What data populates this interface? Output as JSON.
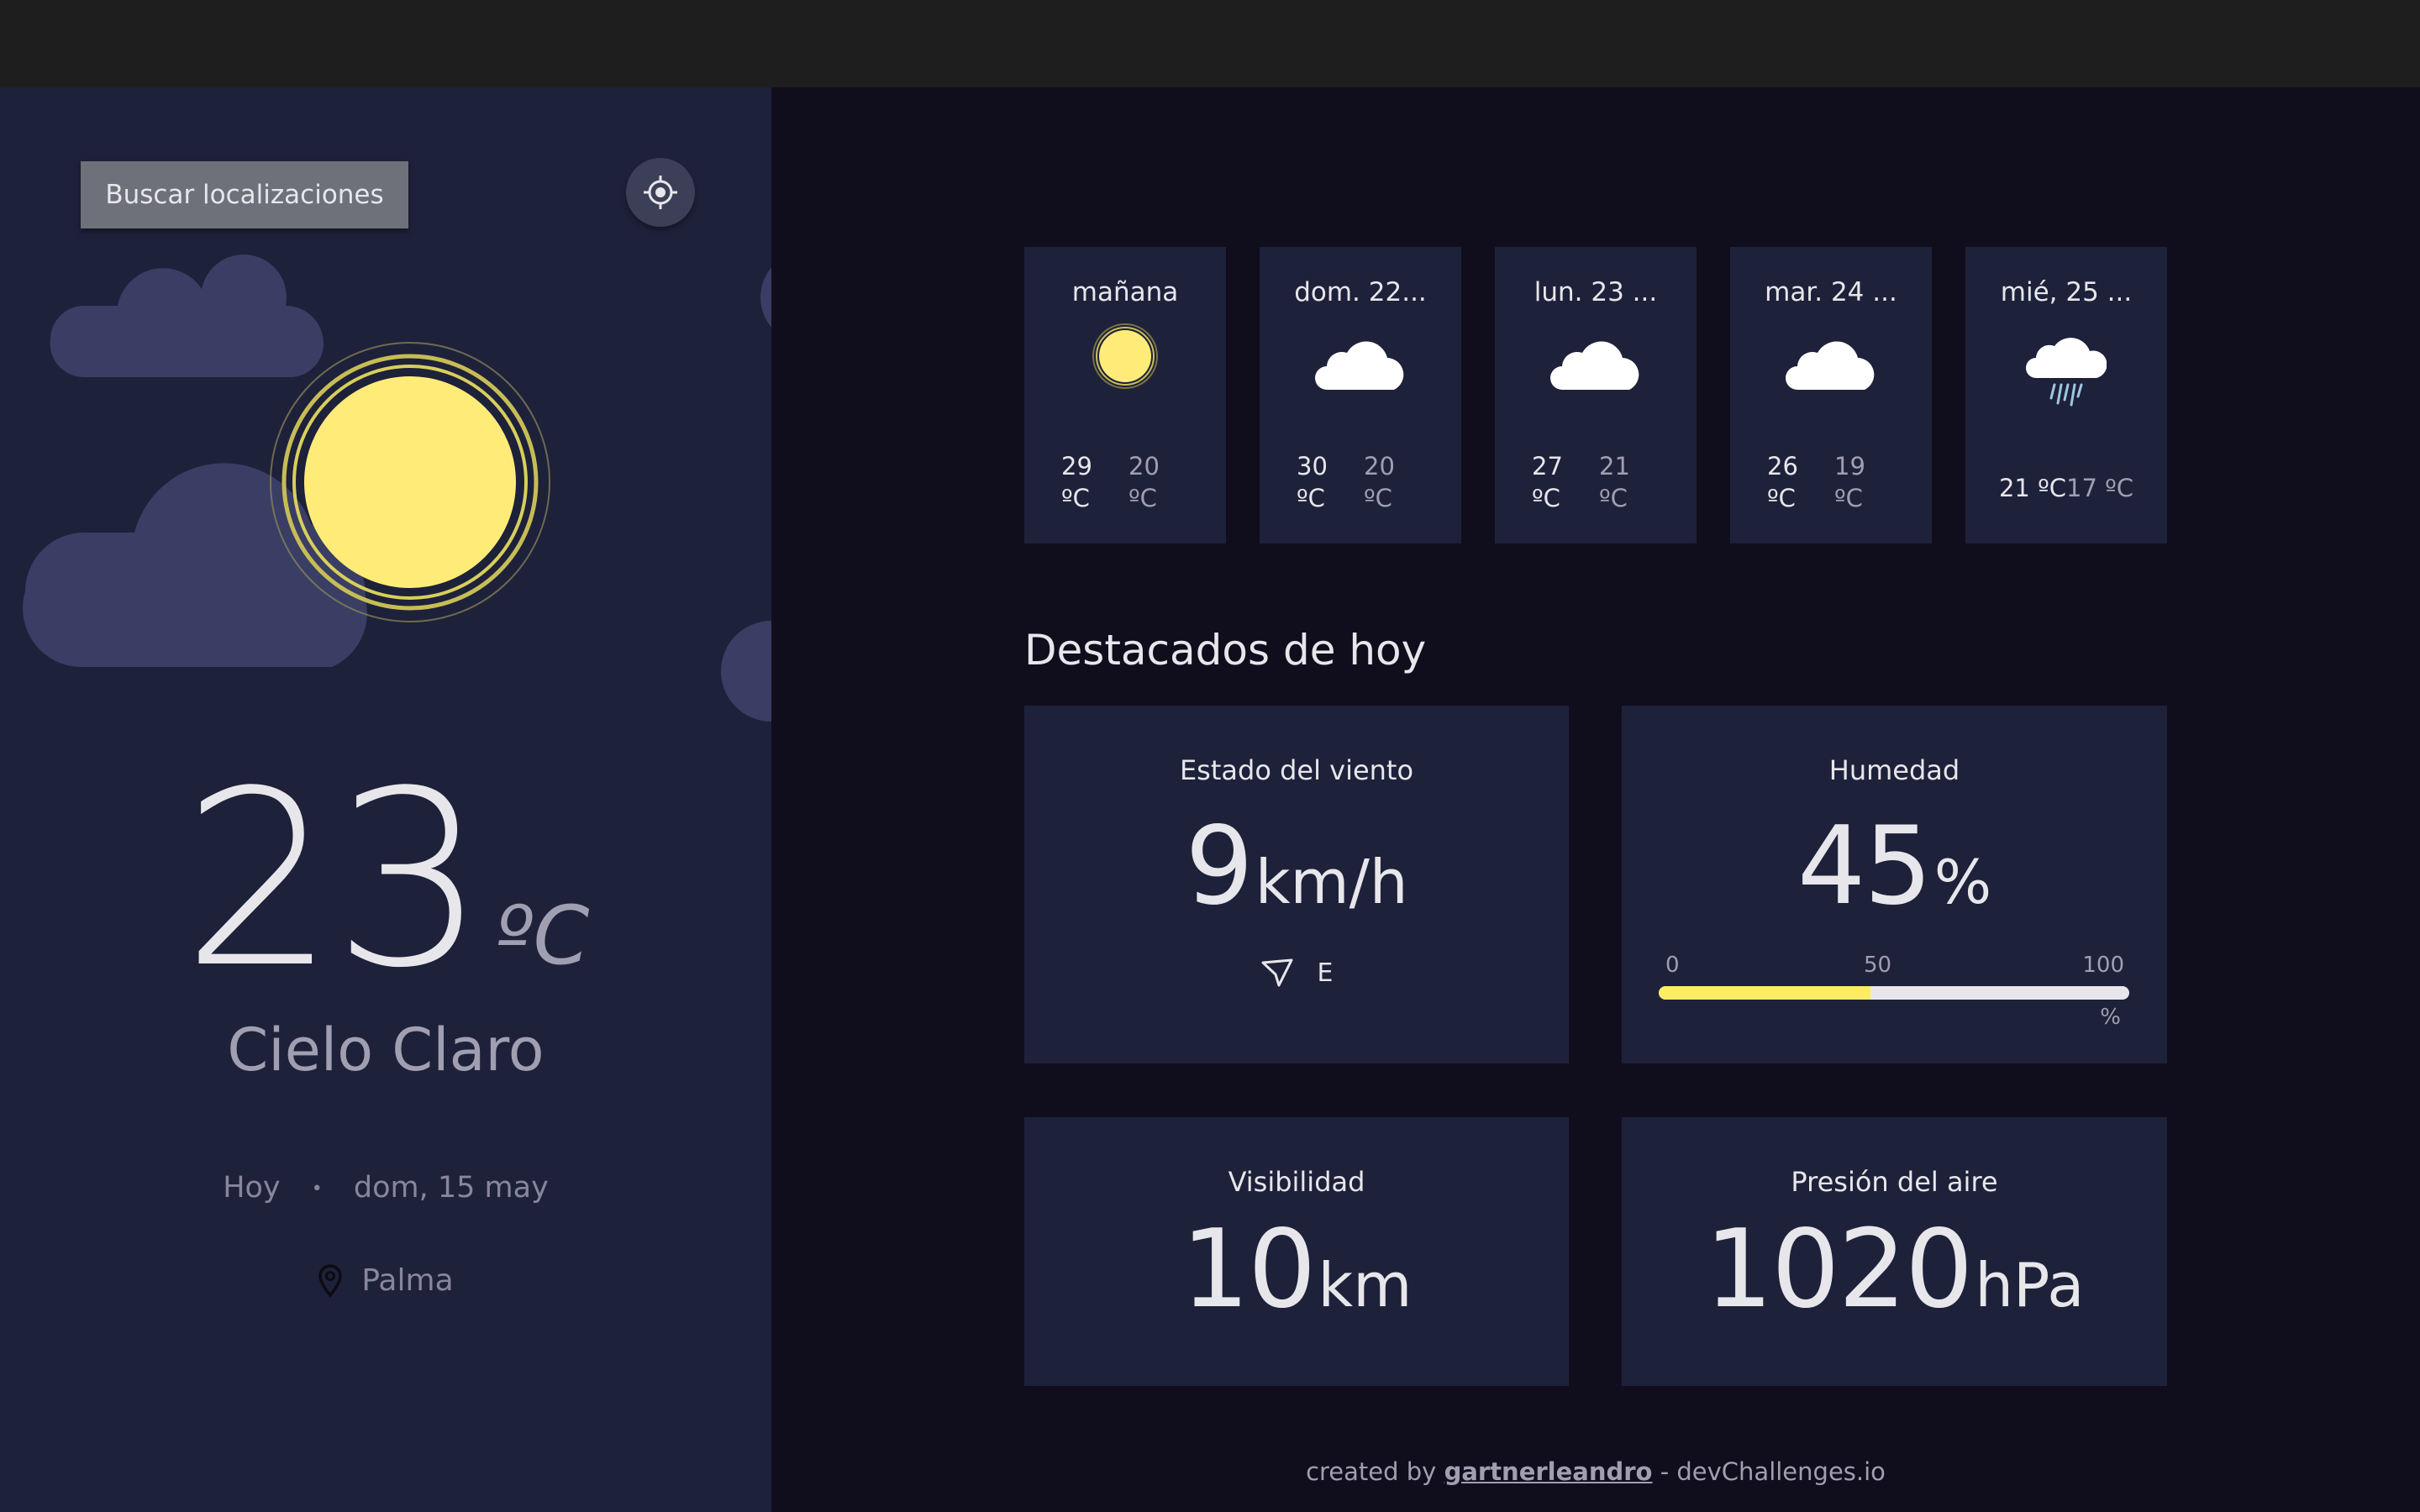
{
  "sidebar": {
    "search_label": "Buscar localizaciones",
    "current": {
      "temperature": "23",
      "unit": "ºC",
      "condition": "Cielo Claro",
      "today_label": "Hoy",
      "separator": "•",
      "date": "dom, 15 may",
      "location": "Palma"
    }
  },
  "forecast": [
    {
      "day": "mañana",
      "icon": "sun-icon",
      "max": "29 ºC",
      "min": "20 ºC"
    },
    {
      "day": "dom. 22...",
      "icon": "cloud-icon",
      "max": "30 ºC",
      "min": "20 ºC"
    },
    {
      "day": "lun. 23 ...",
      "icon": "cloud-icon",
      "max": "27 ºC",
      "min": "21 ºC"
    },
    {
      "day": "mar. 24 ...",
      "icon": "cloud-icon",
      "max": "26 ºC",
      "min": "19 ºC"
    },
    {
      "day": "mié, 25 ...",
      "icon": "rain-cloud-icon",
      "max": "21 ºC",
      "min": "17 ºC"
    }
  ],
  "highlights": {
    "title": "Destacados de hoy",
    "wind": {
      "title": "Estado del viento",
      "value": "9",
      "unit": "km/h",
      "direction": "E"
    },
    "humidity": {
      "title": "Humedad",
      "value": "45",
      "unit": "%",
      "scale_min": "0",
      "scale_mid": "50",
      "scale_max": "100",
      "scale_unit": "%",
      "level": 0.45
    },
    "visibility": {
      "title": "Visibilidad",
      "value": "10",
      "unit": "km"
    },
    "pressure": {
      "title": "Presión del aire",
      "value": "1020",
      "unit": "hPa"
    }
  },
  "footer": {
    "prefix": "created by",
    "author": "gartnerleandro",
    "suffix": "- devChallenges.io"
  },
  "colors": {
    "sun": "#ffec65",
    "card": "#1e213a",
    "background": "#100e1d",
    "cloud": "#3c4166"
  }
}
